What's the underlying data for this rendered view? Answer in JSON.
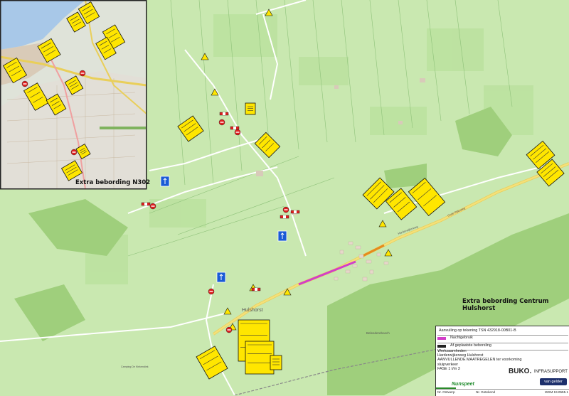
{
  "map": {
    "inset_label": "Extra bebording N302",
    "centrum_label": "Extra bebording Centrum Hulshorst",
    "place_labels": [
      "Hulshorst",
      "Oude Rijksweg",
      "Harderwijkerweg",
      "Beleedereboech",
      "Camping De Kiekendiek"
    ],
    "colors": {
      "background": "#c9e8b0",
      "field": "#bfe3a4",
      "forest": "#a5d483",
      "road_major": "#f0dc78",
      "road_minor": "#ffffff",
      "route_magenta": "#d23ec9",
      "water": "#a8c8e8",
      "sign_yellow": "#ffe600",
      "sign_red": "#e02020",
      "sign_blue": "#1a5bd6"
    },
    "icons": [
      "warning-sign-icon",
      "road-closed-barrier-icon",
      "no-entry-sign-icon",
      "detour-arrow-icon",
      "info-board-icon"
    ]
  },
  "title_block": {
    "line1": "Aanvulling op tekening TSN 432918-00B01-B",
    "legend": [
      {
        "label": "Nachtgebruik",
        "color": "#d23ec9"
      },
      {
        "label": "Af geplaatste beborsling",
        "color": "#222222"
      }
    ],
    "description": [
      "Werkzaamheden",
      "Harderwijkerweg Hulshorst",
      "AANVULLENDE MAATREGELEN ter voorkoming sluipverkeer",
      "FASE 1 t/m 3"
    ],
    "client_logo": "Nunspeet",
    "buko": "BUKO.",
    "infrasupport": "INFRASUPPORT",
    "vangelder": "van gelder",
    "footer_left": "Nr. Ontwerp",
    "footer_mid": "Nr. Getekend",
    "footer_right": "WSM 19.0555.1"
  }
}
